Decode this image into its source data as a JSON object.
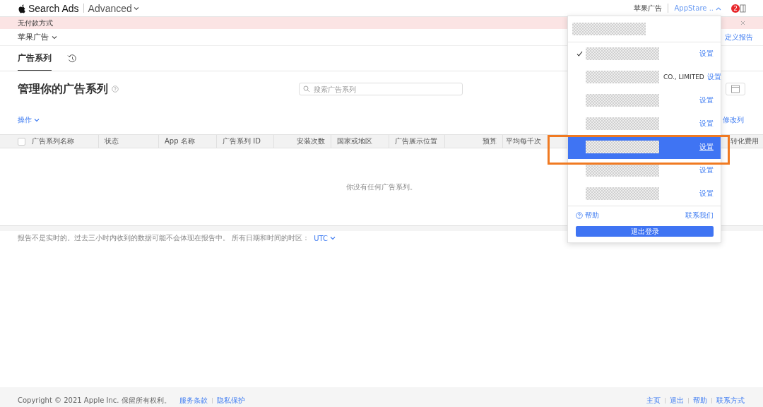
{
  "header": {
    "brand": "Search Ads",
    "product": "Advanced",
    "nav_link": "苹果广告",
    "account": "AppStare ..",
    "notification_count": "2"
  },
  "banner": {
    "text": "无付款方式"
  },
  "org_selector": "苹果广告",
  "custom_report": "定义报告",
  "tabs": [
    {
      "kind": "text",
      "label": "广告系列",
      "selected": true
    },
    {
      "kind": "history",
      "selected": false
    }
  ],
  "page_title": "管理你的广告系列",
  "search": {
    "placeholder": "搜索广告系列"
  },
  "actions_menu": "操作",
  "edit_columns": "修改列",
  "table": {
    "select_all_checked": false,
    "columns": [
      {
        "label": "广告系列名称"
      },
      {
        "label": "状态"
      },
      {
        "label": "App 名称"
      },
      {
        "label": "广告系列 ID"
      },
      {
        "label": "安装次数"
      },
      {
        "label": "国家或地区"
      },
      {
        "label": "广告展示位置"
      },
      {
        "label": "预算"
      },
      {
        "label": "平均每千次"
      },
      {
        "label": "转化费用"
      }
    ],
    "empty_message": "你没有任何广告系列。"
  },
  "notice": {
    "text": "报告不是实时的。过去三小时内收到的数据可能不会体现在报告中。 所有日期和时间的时区：",
    "timezone": "UTC"
  },
  "footer": {
    "copyright": "Copyright © 2021 Apple Inc. 保留所有权利。",
    "links": [
      "服务条款",
      "隐私保护"
    ],
    "nav": [
      "主页",
      "退出",
      "帮助",
      "联系方式"
    ]
  },
  "account_menu": {
    "items": [
      {
        "checked": true,
        "selected": false,
        "action": "设置"
      },
      {
        "checked": false,
        "selected": false,
        "suffix": "CO., LIMITED",
        "action": "设置"
      },
      {
        "checked": false,
        "selected": false,
        "action": "设置"
      },
      {
        "checked": false,
        "selected": false,
        "action": "设置"
      },
      {
        "checked": false,
        "selected": true,
        "action": "设置"
      },
      {
        "checked": false,
        "selected": false,
        "action": "设置"
      },
      {
        "checked": false,
        "selected": false,
        "action": "设置"
      }
    ],
    "help": "帮助",
    "contact": "联系我们",
    "logout": "退出登录"
  }
}
